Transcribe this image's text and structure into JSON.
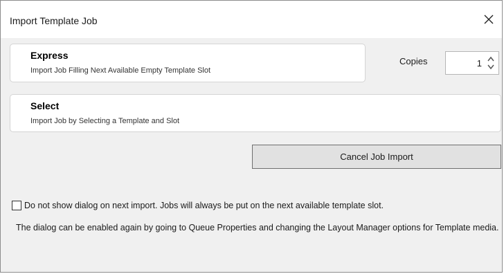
{
  "window": {
    "title": "Import Template Job"
  },
  "options": {
    "express": {
      "title": "Express",
      "description": "Import Job Filling Next Available Empty Template Slot"
    },
    "select": {
      "title": "Select",
      "description": "Import Job by Selecting a Template and Slot"
    }
  },
  "copies": {
    "label": "Copies",
    "value": "1"
  },
  "buttons": {
    "cancel_label": "Cancel Job Import"
  },
  "checkbox": {
    "label": "Do not show dialog on next import. Jobs will always be put on the next available template slot.",
    "checked": false
  },
  "note": {
    "text": "The dialog can be enabled again by going to Queue Properties and changing the Layout Manager options for Template media."
  },
  "icons": {
    "close": "close-icon",
    "spin_up": "chevron-up-icon",
    "spin_down": "chevron-down-icon"
  }
}
